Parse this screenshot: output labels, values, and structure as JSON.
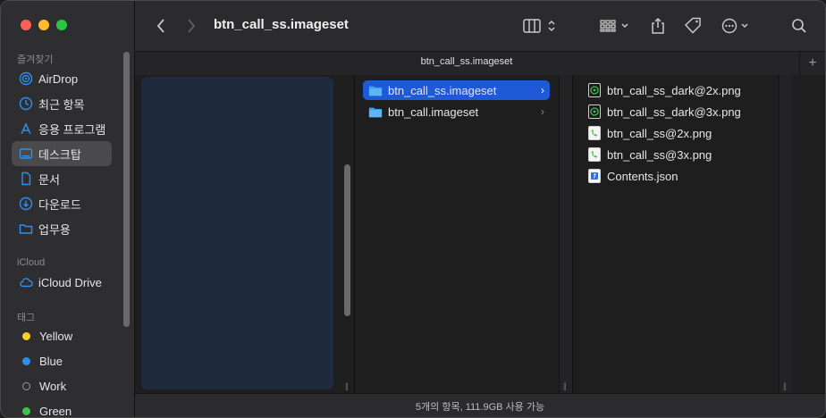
{
  "window": {
    "title": "btn_call_ss.imageset"
  },
  "sidebar": {
    "favorites_header": "즐겨찾기",
    "favorites": [
      {
        "label": "AirDrop",
        "icon": "airdrop-icon"
      },
      {
        "label": "최근 항목",
        "icon": "recents-clock-icon"
      },
      {
        "label": "응용 프로그램",
        "icon": "applications-icon"
      },
      {
        "label": "데스크탑",
        "icon": "desktop-icon",
        "selected": true
      },
      {
        "label": "문서",
        "icon": "document-icon"
      },
      {
        "label": "다운로드",
        "icon": "download-icon"
      },
      {
        "label": "업무용",
        "icon": "folder-icon"
      }
    ],
    "icloud_header": "iCloud",
    "icloud": [
      {
        "label": "iCloud Drive",
        "icon": "cloud-icon"
      }
    ],
    "tags_header": "태그",
    "tags": [
      {
        "label": "Yellow",
        "color": "#f5d224"
      },
      {
        "label": "Blue",
        "color": "#2f8fef"
      },
      {
        "label": "Work",
        "color": ""
      },
      {
        "label": "Green",
        "color": "#3dc24a"
      }
    ]
  },
  "tab": {
    "title": "btn_call_ss.imageset",
    "add": "+"
  },
  "column2": {
    "items": [
      {
        "label": "btn_call_ss.imageset",
        "selected": true
      },
      {
        "label": "btn_call.imageset",
        "selected": false
      }
    ]
  },
  "column3": {
    "items": [
      {
        "label": "btn_call_ss_dark@2x.png",
        "icon": "png-dark-phone-icon"
      },
      {
        "label": "btn_call_ss_dark@3x.png",
        "icon": "png-dark-phone-icon"
      },
      {
        "label": "btn_call_ss@2x.png",
        "icon": "png-light-phone-icon"
      },
      {
        "label": "btn_call_ss@3x.png",
        "icon": "png-light-phone-icon"
      },
      {
        "label": "Contents.json",
        "icon": "json-file-icon"
      }
    ]
  },
  "status": {
    "text": "5개의 항목, 111.9GB 사용 가능"
  },
  "colors": {
    "selection": "#1f5ad6",
    "folder": "#3ea3ee"
  }
}
